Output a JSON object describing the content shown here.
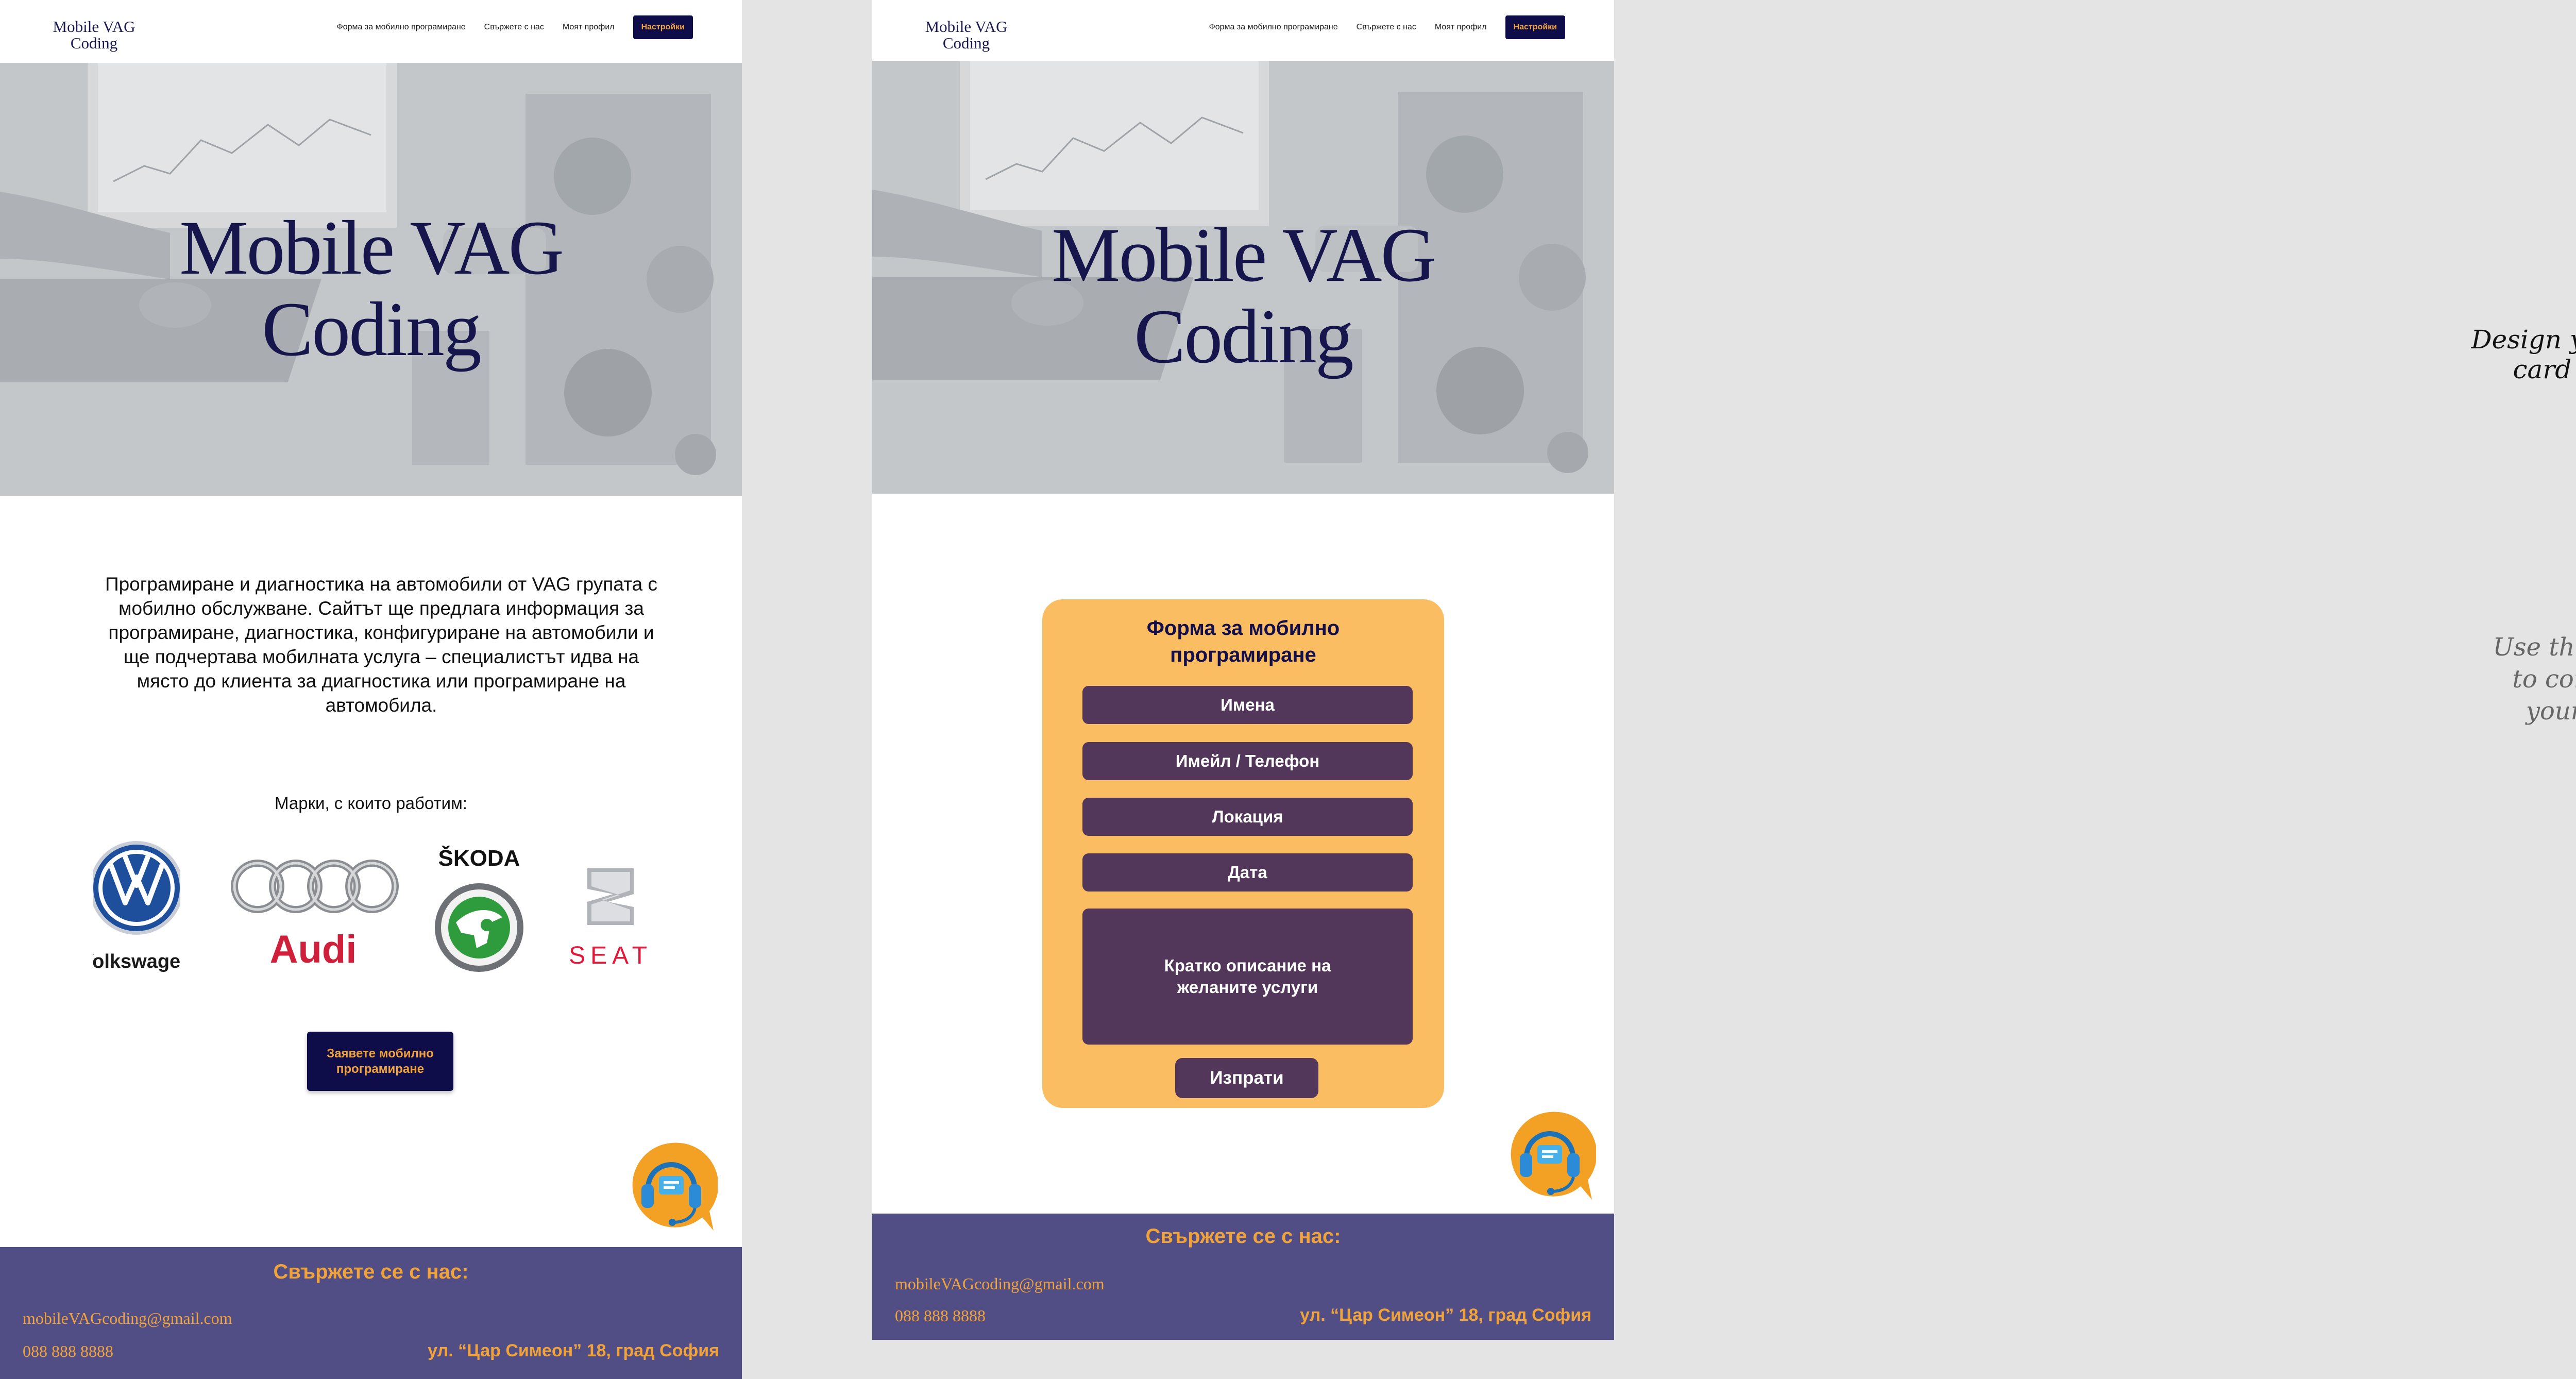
{
  "site": {
    "logo_line1": "Mobile VAG",
    "logo_line2": "Coding",
    "nav": {
      "link1": "Форма за мобилно програмиране",
      "link2": "Свържете с нас",
      "link3": "Моят профил",
      "button": "Настройки"
    },
    "hero": {
      "line1": "Mobile VAG",
      "line2": "Coding"
    },
    "footer": {
      "title": "Свържете се с нас:",
      "email": "mobileVAGcoding@gmail.com",
      "phone": "088 888 8888",
      "address": "ул. “Цар Симеон” 18, град София"
    }
  },
  "home": {
    "intro": "Програмиране и диагностика на автомобили от VAG групата с мобилно обслужване. Сайтът ще предлага информация за програмиране, диагностика, конфигуриране на автомобили и ще подчертава мобилната услуга – специалистът идва на място до клиента за диагностика или програмиране на автомобила.",
    "brands_title": "Марки, с които работим:",
    "brands": [
      "Volkswagen",
      "Audi",
      "ŠKODA",
      "SEAT"
    ],
    "cta_line1": "Заявете мобилно",
    "cta_line2": "програмиране"
  },
  "form": {
    "title_line1": "Форма за мобилно",
    "title_line2": "програмиране",
    "fields": [
      "Имена",
      "Имейл / Телефон",
      "Локация",
      "Дата"
    ],
    "description_line1": "Кратко описание на",
    "description_line2": "желаните услуги",
    "submit": "Изпрати"
  },
  "notes": {
    "design_line1": "Design your own",
    "design_line2": "card here!",
    "image_line1": "Use this image",
    "image_line2": "to complete",
    "image_line3": "your card"
  },
  "colors": {
    "navy": "#0f0c4a",
    "orange": "#f1a33b",
    "footer": "#514d85",
    "form_card": "#fbbd62",
    "form_field": "#52375a"
  }
}
